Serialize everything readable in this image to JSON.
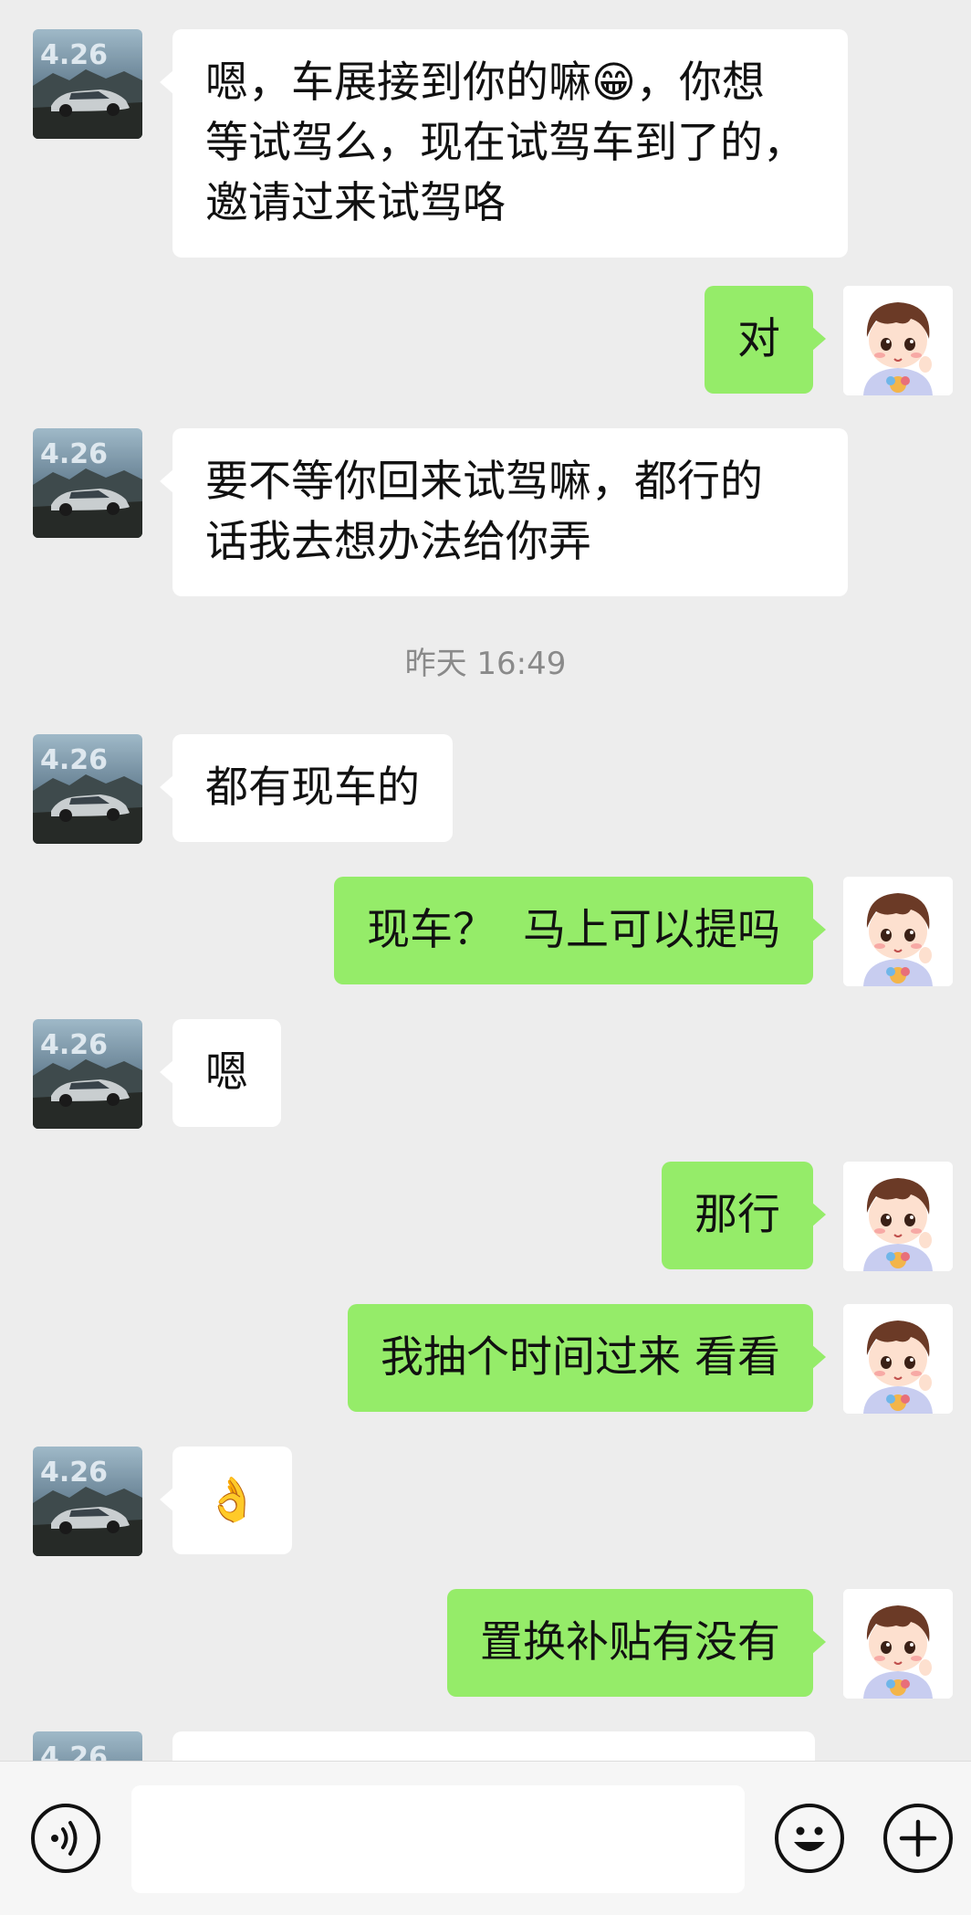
{
  "colors": {
    "background": "#ededed",
    "incoming_bubble": "#ffffff",
    "outgoing_bubble": "#95ec69",
    "timestamp_text": "#8a8a8a"
  },
  "contact_avatar": {
    "icon": "car-photo-avatar",
    "badge_text": "4.26"
  },
  "self_avatar": {
    "icon": "cartoon-boy-avatar"
  },
  "timestamp": "昨天 16:49",
  "messages": [
    {
      "side": "incoming",
      "text": "嗯，车展接到你的嘛😁，你想\n等试驾么，现在试驾车到了的，\n邀请过来试驾咯"
    },
    {
      "side": "outgoing",
      "text": "对"
    },
    {
      "side": "incoming",
      "text": "要不等你回来试驾嘛，都行的\n话我去想办法给你弄"
    },
    {
      "side": "incoming",
      "text": "都有现车的"
    },
    {
      "side": "outgoing",
      "text": "现车？  马上可以提吗"
    },
    {
      "side": "incoming",
      "text": "嗯"
    },
    {
      "side": "outgoing",
      "text": "那行"
    },
    {
      "side": "outgoing",
      "text": "我抽个时间过来 看看"
    },
    {
      "side": "incoming",
      "text": "👌"
    },
    {
      "side": "outgoing",
      "text": "置换补贴有没有"
    }
  ],
  "input_bar": {
    "voice_icon": "voice-icon",
    "emoji_icon": "emoji-icon",
    "plus_icon": "plus-icon",
    "message_value": ""
  }
}
